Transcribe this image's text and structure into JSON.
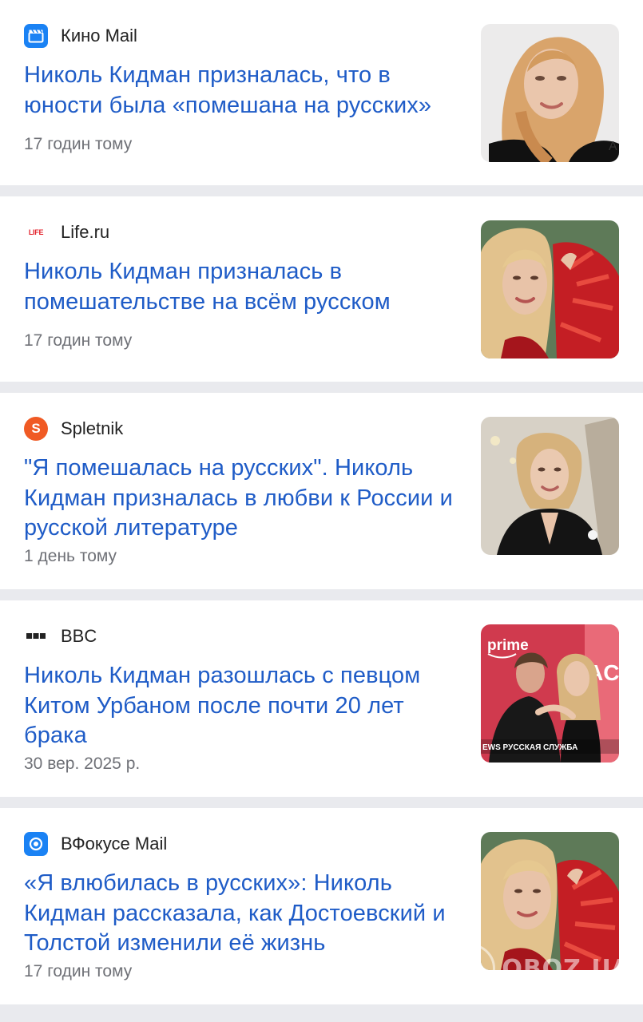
{
  "articles": [
    {
      "source": "Кино Mail",
      "source_icon": "clapperboard-icon",
      "icon_color": "#1a82f4",
      "title": "Николь Кидман призналась, что в юности была «помешана на русских»",
      "time": "17 годин тому",
      "thumbnail": "portrait-photo"
    },
    {
      "source": "Life.ru",
      "source_icon": "life-logo-icon",
      "icon_color": "#e3222b",
      "icon_text": "LIFE",
      "title": "Николь Кидман призналась в помешательстве на всём русском",
      "time": "17 годин тому",
      "thumbnail": "portrait-red-feathers-photo"
    },
    {
      "source": "Spletnik",
      "source_icon": "spletnik-logo-icon",
      "icon_color": "#f05a24",
      "icon_text": "S",
      "title": "\"Я помешалась на русских\". Николь Кидман призналась в любви к России и русской литературе",
      "time": "1 день тому",
      "thumbnail": "portrait-black-blazer-photo"
    },
    {
      "source": "BBC",
      "source_icon": "bbc-logo-icon",
      "icon_color": "#222222",
      "title": "Николь Кидман разошлась с певцом Китом Урбаном после почти 20 лет брака",
      "time": "30 вер. 2025 р.",
      "thumbnail": "couple-red-carpet-photo",
      "thumb_labels": {
        "brand": "prime",
        "side": "ACA",
        "caption": "EWS РУССКАЯ СЛУЖБА"
      }
    },
    {
      "source": "ВФокусе Mail",
      "source_icon": "vfokuse-lens-icon",
      "icon_color": "#1a82f4",
      "title": "«Я влюбилась в русских»: Николь Кидман рассказала, как Достоевский и Толстой изменили её жизнь",
      "time": "17 годин тому",
      "thumbnail": "portrait-red-feathers-photo"
    }
  ],
  "watermark": "OBOZ.UA"
}
